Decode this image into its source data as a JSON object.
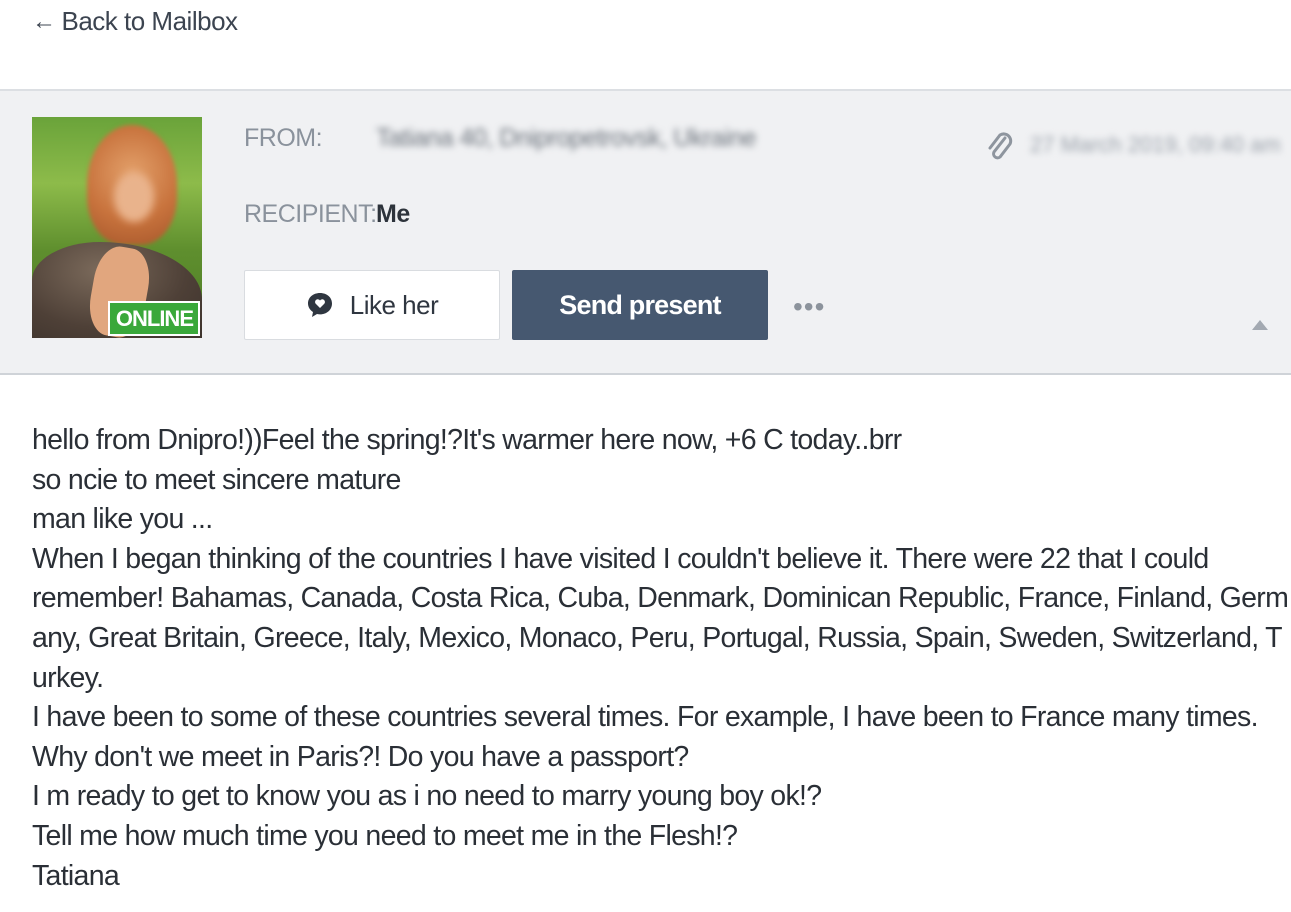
{
  "nav": {
    "back_arrow": "←",
    "back_label": "Back to Mailbox"
  },
  "sender": {
    "avatar_icon": "profile-photo",
    "status_badge": "ONLINE",
    "from_label": "FROM:",
    "from_value": "Tatiana 40, Dnipropetrovsk, Ukraine",
    "recipient_label": "RECIPIENT:",
    "recipient_value": "Me",
    "date_value": "27 March 2019, 09:40 am",
    "attachment_icon": "paperclip-icon"
  },
  "actions": {
    "like_label": "Like her",
    "like_icon": "heart-bubble-icon",
    "present_label": "Send present",
    "more_label": "•••"
  },
  "message": {
    "lines": [
      "hello from Dnipro!))Feel the spring!?It's warmer here now, +6 C today..brr",
      "so ncie to meet sincere mature",
      "man like you ...",
      "When I began thinking of the countries I have visited I couldn't believe it. There were 22 that I could",
      "remember! Bahamas, Canada, Costa Rica, Cuba, Denmark, Dominican Republic, France, Finland, Germ",
      "any, Great Britain, Greece, Italy, Mexico, Monaco, Peru, Portugal, Russia, Spain, Sweden, Switzerland, T",
      "urkey.",
      "I have been to some of these countries several times. For example, I have been to France many times.",
      "Why don't we meet in Paris?! Do you have a passport?",
      "I m ready to get to know you as i no need to marry young boy ok!?",
      "Tell me how much time you need to meet me in the Flesh!?",
      "Tatiana"
    ]
  },
  "colors": {
    "panel_bg": "#f0f1f3",
    "present_button": "#465870",
    "online_badge": "#3aa83a"
  }
}
